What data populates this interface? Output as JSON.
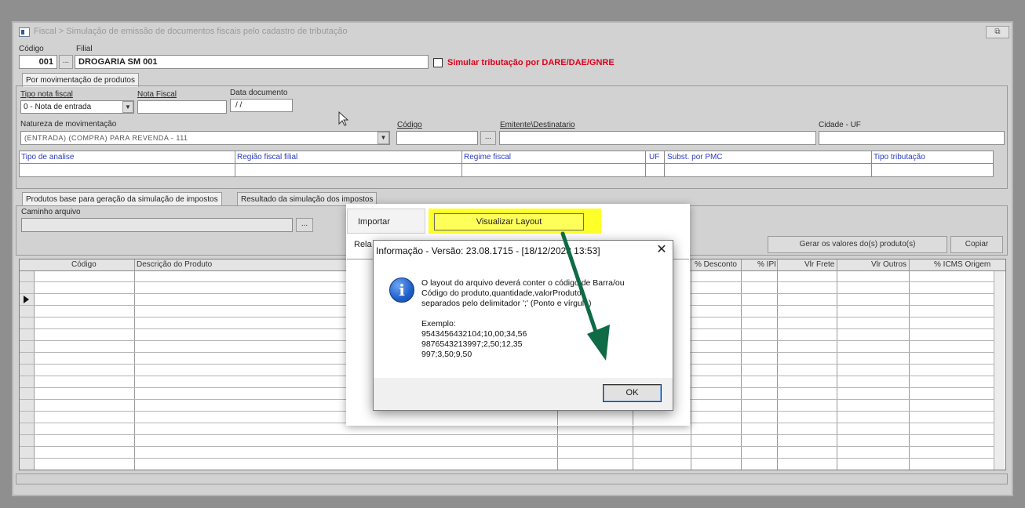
{
  "window": {
    "title": "Fiscal > Simulação de emissão de documentos fiscais pelo cadastro de tributação"
  },
  "header": {
    "codigo_label": "Código",
    "codigo_value": "001",
    "filial_label": "Filial",
    "filial_value": "DROGARIA SM 001",
    "simular_label": "Simular tributação por DARE/DAE/GNRE"
  },
  "tabs_top": [
    "Por movimentação de produtos"
  ],
  "form": {
    "tipo_nota_label": "Tipo nota fiscal",
    "tipo_nota_value": "0 - Nota de entrada",
    "nota_fiscal_label": "Nota Fiscal",
    "data_doc_label": "Data documento",
    "data_doc_value": "/ /",
    "natureza_label": "Natureza de movimentação",
    "natureza_value": "(ENTRADA) (COMPRA) PARA REVENDA - 111",
    "codigo_label": "Código",
    "emitente_label": "Emitente\\Destinatario",
    "cidade_label": "Cidade - UF"
  },
  "analysis_headers": [
    "Tipo de analise",
    "Região fiscal filial",
    "Regime fiscal",
    "UF",
    "Subst. por PMC",
    "Tipo tributação"
  ],
  "tabs_bottom": [
    "Produtos base para geração da simulação de impostos",
    "Resultado da simulação dos impostos"
  ],
  "caminho_label": "Caminho arquivo",
  "buttons": {
    "browse": "...",
    "gerar": "Gerar os valores do(s) produto(s)",
    "copiar": "Copiar"
  },
  "grid_headers": [
    "Código",
    "Descrição do Produto",
    "rio",
    "% Desconto",
    "% IPI",
    "Vlr Frete",
    "Vlr Outros",
    "% ICMS Origem"
  ],
  "popup": {
    "importar": "Importar",
    "visualizar": "Visualizar Layout",
    "rel": "Rela"
  },
  "dialog": {
    "title": "Informação - Versão: 23.08.1715 - [18/12/2023 13:53]",
    "close": "✕",
    "icon_letter": "i",
    "message": "O layout do arquivo deverá conter o código de Barra/ou\nCódigo do produto,quantidade,valorProduto\nseparados pelo delimitador ';' (Ponto e vírgula)\n\nExemplo:\n9543456432104;10,00;34,56\n9876543213997;2,50;12,35\n997;3,50;9,50",
    "ok": "OK"
  },
  "colors": {
    "highlight": "#ffff2a",
    "arrow": "#0f6b45",
    "simular_red": "#e0001a"
  }
}
